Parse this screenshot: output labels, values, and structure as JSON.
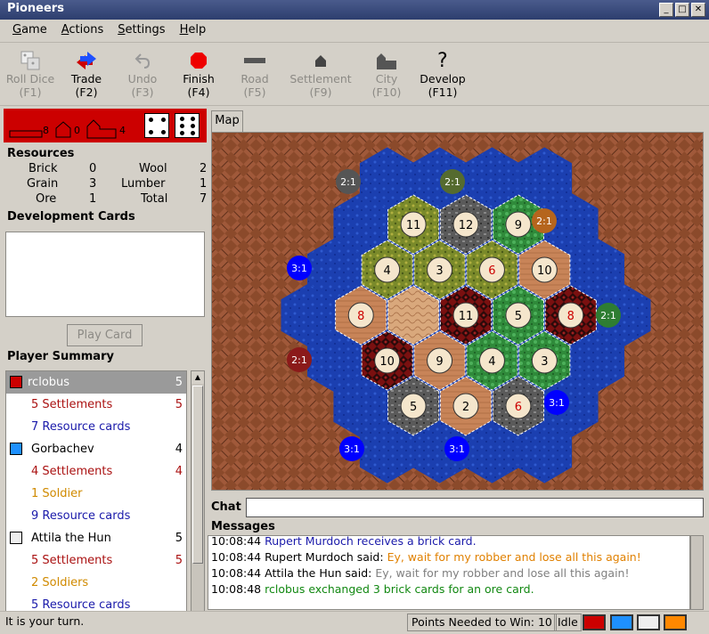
{
  "window": {
    "title": "Pioneers",
    "min": "_",
    "max": "□",
    "close": "✕"
  },
  "menu": [
    {
      "accel": "G",
      "rest": "ame"
    },
    {
      "accel": "A",
      "rest": "ctions"
    },
    {
      "accel": "S",
      "rest": "ettings"
    },
    {
      "accel": "H",
      "rest": "elp"
    }
  ],
  "toolbar": {
    "roll_dice": {
      "label": "Roll Dice",
      "key": "(F1)"
    },
    "trade": {
      "label": "Trade",
      "key": "(F2)"
    },
    "undo": {
      "label": "Undo",
      "key": "(F3)"
    },
    "finish": {
      "label": "Finish",
      "key": "(F4)"
    },
    "road": {
      "label": "Road",
      "key": "(F5)"
    },
    "settlement": {
      "label": "Settlement",
      "key": "(F9)"
    },
    "city": {
      "label": "City",
      "key": "(F10)"
    },
    "develop": {
      "label": "Develop",
      "key": "(F11)"
    }
  },
  "player_bar": {
    "roads": "8",
    "settlements": "0",
    "cities": "4",
    "dice": [
      4,
      6
    ]
  },
  "resources": {
    "title": "Resources",
    "items": [
      {
        "name": "Brick",
        "value": "0",
        "name2": "Wool",
        "value2": "2"
      },
      {
        "name": "Grain",
        "value": "3",
        "name2": "Lumber",
        "value2": "1"
      },
      {
        "name": "Ore",
        "value": "1",
        "name2": "Total",
        "value2": "7"
      }
    ]
  },
  "dev_cards": {
    "title": "Development Cards",
    "play_button": "Play Card"
  },
  "player_summary": {
    "title": "Player Summary",
    "rows": [
      {
        "text": "rclobus",
        "num": "5",
        "color": "#cc0000",
        "type": "player",
        "selected": true
      },
      {
        "text": "5 Settlements",
        "num": "5",
        "type": "settle"
      },
      {
        "text": "7 Resource cards",
        "num": "",
        "type": "res"
      },
      {
        "text": "Gorbachev",
        "num": "4",
        "color": "#1e90ff",
        "type": "player"
      },
      {
        "text": "4 Settlements",
        "num": "4",
        "type": "settle"
      },
      {
        "text": "1 Soldier",
        "num": "",
        "type": "soldier"
      },
      {
        "text": "9 Resource cards",
        "num": "",
        "type": "res"
      },
      {
        "text": "Attila the Hun",
        "num": "5",
        "color": "#eeeeee",
        "type": "player"
      },
      {
        "text": "5 Settlements",
        "num": "5",
        "type": "settle"
      },
      {
        "text": "2 Soldiers",
        "num": "",
        "type": "soldier"
      },
      {
        "text": "5 Resource cards",
        "num": "",
        "type": "res"
      }
    ]
  },
  "map": {
    "tab": "Map",
    "tiles": [
      {
        "n": "11",
        "t": "grain"
      },
      {
        "n": "12",
        "t": "ore"
      },
      {
        "n": "9",
        "t": "wool"
      },
      {
        "n": "4",
        "t": "grain"
      },
      {
        "n": "3",
        "t": "grain"
      },
      {
        "n": "6",
        "t": "grain"
      },
      {
        "n": "10",
        "t": "brick"
      },
      {
        "n": "8",
        "t": "brick"
      },
      {
        "n": "",
        "t": "desert"
      },
      {
        "n": "11",
        "t": "lumber"
      },
      {
        "n": "5",
        "t": "wool"
      },
      {
        "n": "8",
        "t": "lumber"
      },
      {
        "n": "10",
        "t": "lumber"
      },
      {
        "n": "9",
        "t": "brick"
      },
      {
        "n": "4",
        "t": "wool"
      },
      {
        "n": "3",
        "t": "wool"
      },
      {
        "n": "5",
        "t": "ore"
      },
      {
        "n": "2",
        "t": "brick"
      },
      {
        "n": "6",
        "t": "ore"
      }
    ],
    "ports": [
      {
        "label": "2:1",
        "color": "#555555"
      },
      {
        "label": "2:1",
        "color": "#556b2f"
      },
      {
        "label": "2:1",
        "color": "#b5651d"
      },
      {
        "label": "3:1",
        "color": "#0000ff"
      },
      {
        "label": "2:1",
        "color": "#2e7d32"
      },
      {
        "label": "2:1",
        "color": "#8b1a1a"
      },
      {
        "label": "3:1",
        "color": "#0000ff"
      },
      {
        "label": "3:1",
        "color": "#0000ff"
      },
      {
        "label": "3:1",
        "color": "#0000ff"
      }
    ]
  },
  "chat": {
    "label": "Chat"
  },
  "messages": {
    "label": "Messages",
    "lines": [
      {
        "time": "10:08:44",
        "who": "Rupert Murdoch receives a brick card.",
        "said": "",
        "who_color": "#1a1aaa",
        "said_color": ""
      },
      {
        "time": "10:08:44",
        "who": "Rupert Murdoch said: ",
        "said": "Ey, wait for my robber and lose all this again!",
        "who_color": "#000000",
        "said_color": "#e08000"
      },
      {
        "time": "10:08:44",
        "who": "Attila the Hun said: ",
        "said": "Ey, wait for my robber and lose all this again!",
        "who_color": "#000000",
        "said_color": "#808080"
      },
      {
        "time": "10:08:48",
        "who": "rclobus exchanged 3 brick cards for an ore card.",
        "said": "",
        "who_color": "#118811",
        "said_color": ""
      }
    ]
  },
  "status": {
    "left": "It is your turn.",
    "points": "Points Needed to Win: 10",
    "state": "Idle",
    "player_colors": [
      "#cc0000",
      "#1e90ff",
      "#eeeeee",
      "#ff8800"
    ]
  }
}
